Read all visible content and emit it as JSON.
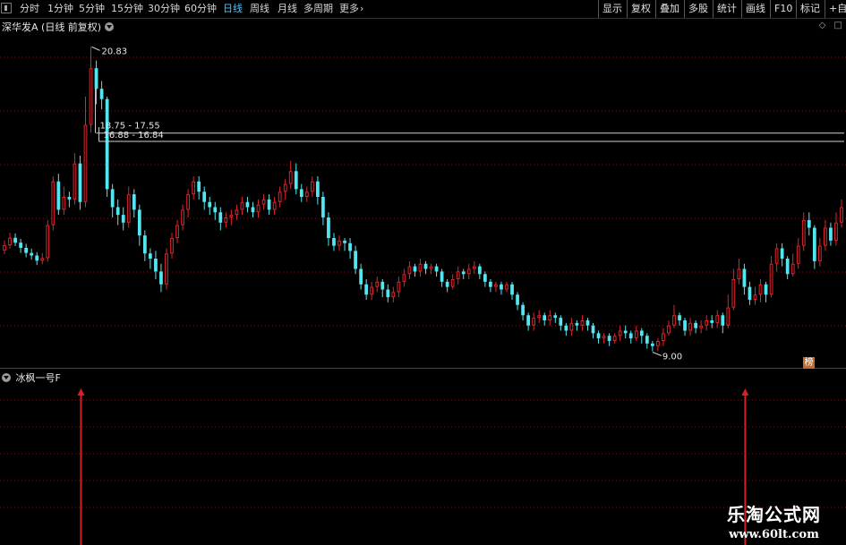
{
  "toolbar": {
    "periods": [
      "分时",
      "1分钟",
      "5分钟",
      "15分钟",
      "30分钟",
      "60分钟",
      "日线",
      "周线",
      "月线",
      "多周期",
      "更多"
    ],
    "active_index": 6,
    "right_buttons": [
      "显示",
      "复权",
      "叠加",
      "多股",
      "统计",
      "画线",
      "F10",
      "标记",
      "+自"
    ]
  },
  "chart_title": "深华发A (日线 前复权)",
  "sub_title": "冰枫一号F",
  "badge": "榜",
  "watermark": {
    "line1": "乐淘公式网",
    "line2": "www.60lt.com"
  },
  "colors": {
    "up": "#e0252d",
    "down": "#54e6f0",
    "box_fill": "#8c8c8c",
    "axis_line": "#b01c1c",
    "grid": "#7a1010"
  },
  "chart_data": {
    "type": "candlestick",
    "annotations": {
      "high_label": "20.83",
      "low_label": "9.00",
      "upper_zone_label": "18.75 - 17.55",
      "lower_zone_label": "16.88 - 16.84",
      "upper_zone_price": [
        17.55,
        18.75
      ],
      "lower_zone_price": [
        16.84,
        16.88
      ]
    },
    "price_range": [
      8.6,
      21.4
    ],
    "signals": {
      "arrow_bar_index": [
        14,
        137
      ]
    },
    "candles": [
      [
        12.92,
        13.12,
        13.31,
        12.77
      ],
      [
        13.12,
        13.41,
        13.61,
        12.99
      ],
      [
        13.41,
        13.22,
        13.58,
        13.09
      ],
      [
        13.22,
        13.02,
        13.37,
        12.82
      ],
      [
        13.02,
        12.82,
        13.18,
        12.65
      ],
      [
        12.82,
        12.72,
        12.99,
        12.56
      ],
      [
        12.72,
        12.52,
        12.85,
        12.35
      ],
      [
        12.52,
        12.62,
        12.82,
        12.38
      ],
      [
        12.62,
        13.9,
        14.1,
        12.48
      ],
      [
        13.9,
        15.6,
        15.8,
        13.7
      ],
      [
        15.6,
        14.5,
        15.9,
        14.3
      ],
      [
        14.5,
        15.0,
        15.4,
        14.3
      ],
      [
        15.0,
        14.9,
        15.2,
        14.6
      ],
      [
        14.9,
        16.3,
        16.7,
        14.7
      ],
      [
        16.3,
        14.8,
        16.6,
        14.5
      ],
      [
        14.8,
        17.8,
        18.9,
        14.6
      ],
      [
        17.8,
        20.0,
        20.83,
        17.5
      ],
      [
        20.0,
        19.2,
        20.3,
        18.6
      ],
      [
        19.2,
        18.8,
        19.5,
        18.4
      ],
      [
        18.8,
        15.3,
        18.9,
        15.0
      ],
      [
        15.3,
        14.6,
        15.5,
        14.2
      ],
      [
        14.6,
        14.3,
        14.9,
        13.9
      ],
      [
        14.3,
        14.0,
        14.6,
        13.7
      ],
      [
        14.0,
        15.1,
        15.4,
        13.8
      ],
      [
        15.1,
        14.5,
        15.3,
        14.2
      ],
      [
        14.5,
        13.5,
        14.7,
        13.1
      ],
      [
        13.5,
        12.8,
        13.7,
        12.5
      ],
      [
        12.8,
        12.6,
        13.0,
        12.2
      ],
      [
        12.6,
        12.1,
        12.9,
        11.8
      ],
      [
        12.1,
        11.6,
        12.4,
        11.3
      ],
      [
        11.6,
        12.8,
        13.0,
        11.4
      ],
      [
        12.8,
        13.4,
        13.6,
        12.6
      ],
      [
        13.4,
        13.9,
        14.1,
        13.2
      ],
      [
        13.9,
        14.5,
        14.7,
        13.7
      ],
      [
        14.5,
        15.1,
        15.3,
        14.2
      ],
      [
        15.1,
        15.6,
        15.8,
        14.9
      ],
      [
        15.6,
        15.2,
        15.8,
        14.9
      ],
      [
        15.2,
        14.8,
        15.4,
        14.5
      ],
      [
        14.8,
        14.6,
        15.0,
        14.3
      ],
      [
        14.6,
        14.4,
        14.8,
        14.1
      ],
      [
        14.4,
        14.0,
        14.6,
        13.7
      ],
      [
        14.0,
        14.2,
        14.4,
        13.8
      ],
      [
        14.2,
        14.3,
        14.5,
        13.9
      ],
      [
        14.3,
        14.5,
        14.7,
        14.1
      ],
      [
        14.5,
        14.8,
        15.0,
        14.3
      ],
      [
        14.8,
        14.6,
        15.0,
        14.4
      ],
      [
        14.6,
        14.4,
        14.8,
        14.2
      ],
      [
        14.4,
        14.7,
        14.9,
        14.2
      ],
      [
        14.7,
        14.9,
        15.1,
        14.5
      ],
      [
        14.9,
        14.5,
        15.1,
        14.3
      ],
      [
        14.5,
        14.8,
        15.0,
        14.3
      ],
      [
        14.8,
        15.2,
        15.4,
        14.6
      ],
      [
        15.2,
        15.5,
        15.7,
        14.9
      ],
      [
        15.5,
        16.0,
        16.4,
        15.3
      ],
      [
        16.0,
        15.3,
        16.3,
        15.1
      ],
      [
        15.3,
        15.0,
        15.5,
        14.8
      ],
      [
        15.0,
        15.2,
        15.4,
        14.8
      ],
      [
        15.2,
        15.6,
        15.8,
        15.0
      ],
      [
        15.6,
        15.0,
        15.8,
        14.7
      ],
      [
        15.0,
        14.2,
        15.2,
        13.9
      ],
      [
        14.2,
        13.4,
        14.4,
        13.1
      ],
      [
        13.4,
        13.1,
        13.6,
        12.9
      ],
      [
        13.1,
        13.3,
        13.5,
        12.9
      ],
      [
        13.3,
        13.2,
        13.4,
        12.9
      ],
      [
        13.2,
        12.9,
        13.4,
        12.6
      ],
      [
        12.9,
        12.2,
        13.1,
        12.0
      ],
      [
        12.2,
        11.6,
        12.4,
        11.4
      ],
      [
        11.6,
        11.2,
        11.8,
        11.0
      ],
      [
        11.2,
        11.5,
        11.7,
        11.0
      ],
      [
        11.5,
        11.7,
        11.9,
        11.3
      ],
      [
        11.7,
        11.4,
        11.8,
        11.1
      ],
      [
        11.4,
        11.1,
        11.6,
        10.9
      ],
      [
        11.1,
        11.3,
        11.5,
        10.9
      ],
      [
        11.3,
        11.7,
        11.9,
        11.1
      ],
      [
        11.7,
        12.0,
        12.2,
        11.5
      ],
      [
        12.0,
        12.3,
        12.5,
        11.8
      ],
      [
        12.3,
        12.1,
        12.4,
        11.9
      ],
      [
        12.1,
        12.4,
        12.6,
        11.9
      ],
      [
        12.4,
        12.2,
        12.5,
        12.0
      ],
      [
        12.2,
        12.3,
        12.4,
        12.0
      ],
      [
        12.3,
        12.1,
        12.4,
        11.9
      ],
      [
        12.1,
        11.7,
        12.2,
        11.5
      ],
      [
        11.7,
        11.5,
        11.8,
        11.3
      ],
      [
        11.5,
        11.8,
        12.0,
        11.4
      ],
      [
        11.8,
        12.1,
        12.3,
        11.6
      ],
      [
        12.1,
        12.0,
        12.2,
        11.8
      ],
      [
        12.0,
        12.2,
        12.4,
        11.8
      ],
      [
        12.2,
        12.3,
        12.5,
        12.0
      ],
      [
        12.3,
        12.0,
        12.4,
        11.8
      ],
      [
        12.0,
        11.7,
        12.1,
        11.5
      ],
      [
        11.7,
        11.5,
        11.8,
        11.3
      ],
      [
        11.5,
        11.6,
        11.7,
        11.3
      ],
      [
        11.6,
        11.4,
        11.7,
        11.2
      ],
      [
        11.4,
        11.6,
        11.7,
        11.3
      ],
      [
        11.6,
        11.2,
        11.7,
        11.0
      ],
      [
        11.2,
        10.8,
        11.3,
        10.6
      ],
      [
        10.8,
        10.4,
        10.9,
        10.2
      ],
      [
        10.4,
        10.0,
        10.5,
        9.8
      ],
      [
        10.0,
        10.3,
        10.5,
        9.8
      ],
      [
        10.3,
        10.4,
        10.6,
        10.1
      ],
      [
        10.4,
        10.2,
        10.5,
        10.0
      ],
      [
        10.2,
        10.4,
        10.6,
        10.0
      ],
      [
        10.4,
        10.3,
        10.5,
        10.1
      ],
      [
        10.3,
        10.0,
        10.4,
        9.8
      ],
      [
        10.0,
        9.8,
        10.1,
        9.6
      ],
      [
        9.8,
        10.1,
        10.3,
        9.6
      ],
      [
        10.1,
        10.0,
        10.2,
        9.8
      ],
      [
        10.0,
        10.2,
        10.4,
        9.8
      ],
      [
        10.2,
        10.0,
        10.3,
        9.8
      ],
      [
        10.0,
        9.7,
        10.1,
        9.5
      ],
      [
        9.7,
        9.5,
        9.8,
        9.3
      ],
      [
        9.5,
        9.6,
        9.7,
        9.3
      ],
      [
        9.6,
        9.4,
        9.7,
        9.2
      ],
      [
        9.4,
        9.6,
        9.7,
        9.3
      ],
      [
        9.6,
        9.8,
        10.0,
        9.4
      ],
      [
        9.8,
        9.7,
        10.0,
        9.5
      ],
      [
        9.7,
        9.5,
        9.8,
        9.3
      ],
      [
        9.5,
        9.8,
        10.0,
        9.4
      ],
      [
        9.8,
        9.6,
        9.9,
        9.3
      ],
      [
        9.6,
        9.3,
        9.7,
        9.1
      ],
      [
        9.3,
        9.2,
        9.4,
        9.0
      ],
      [
        9.2,
        9.4,
        9.5,
        9.0
      ],
      [
        9.4,
        9.7,
        9.9,
        9.2
      ],
      [
        9.7,
        10.0,
        10.2,
        9.6
      ],
      [
        10.0,
        10.4,
        10.8,
        9.9
      ],
      [
        10.4,
        10.2,
        10.5,
        10.0
      ],
      [
        10.2,
        9.8,
        10.3,
        9.6
      ],
      [
        9.8,
        10.1,
        10.3,
        9.6
      ],
      [
        10.1,
        9.9,
        10.2,
        9.7
      ],
      [
        9.9,
        10.0,
        10.2,
        9.7
      ],
      [
        10.0,
        10.2,
        10.4,
        9.8
      ],
      [
        10.2,
        10.1,
        10.4,
        9.9
      ],
      [
        10.1,
        10.4,
        10.6,
        9.9
      ],
      [
        10.4,
        10.0,
        10.5,
        9.7
      ],
      [
        10.0,
        10.7,
        11.2,
        9.9
      ],
      [
        10.7,
        11.8,
        12.2,
        10.6
      ],
      [
        11.8,
        12.2,
        12.6,
        11.6
      ],
      [
        12.2,
        11.5,
        12.4,
        11.2
      ],
      [
        11.5,
        11.0,
        11.7,
        10.8
      ],
      [
        11.0,
        11.2,
        11.5,
        10.8
      ],
      [
        11.2,
        11.6,
        11.8,
        10.9
      ],
      [
        11.6,
        11.2,
        11.7,
        10.9
      ],
      [
        11.2,
        12.4,
        12.7,
        11.1
      ],
      [
        12.4,
        13.0,
        13.2,
        12.1
      ],
      [
        13.0,
        12.6,
        13.2,
        12.3
      ],
      [
        12.6,
        12.0,
        12.7,
        11.8
      ],
      [
        12.0,
        12.4,
        12.8,
        11.9
      ],
      [
        12.4,
        13.1,
        13.4,
        12.2
      ],
      [
        13.1,
        14.1,
        14.4,
        12.9
      ],
      [
        14.1,
        13.8,
        14.4,
        13.5
      ],
      [
        13.8,
        12.5,
        13.9,
        12.2
      ],
      [
        12.5,
        13.1,
        13.4,
        12.3
      ],
      [
        13.1,
        13.8,
        14.1,
        12.9
      ],
      [
        13.8,
        13.3,
        14.0,
        13.1
      ],
      [
        13.3,
        14.0,
        14.4,
        13.1
      ],
      [
        14.0,
        14.6,
        14.9,
        13.8
      ]
    ]
  }
}
